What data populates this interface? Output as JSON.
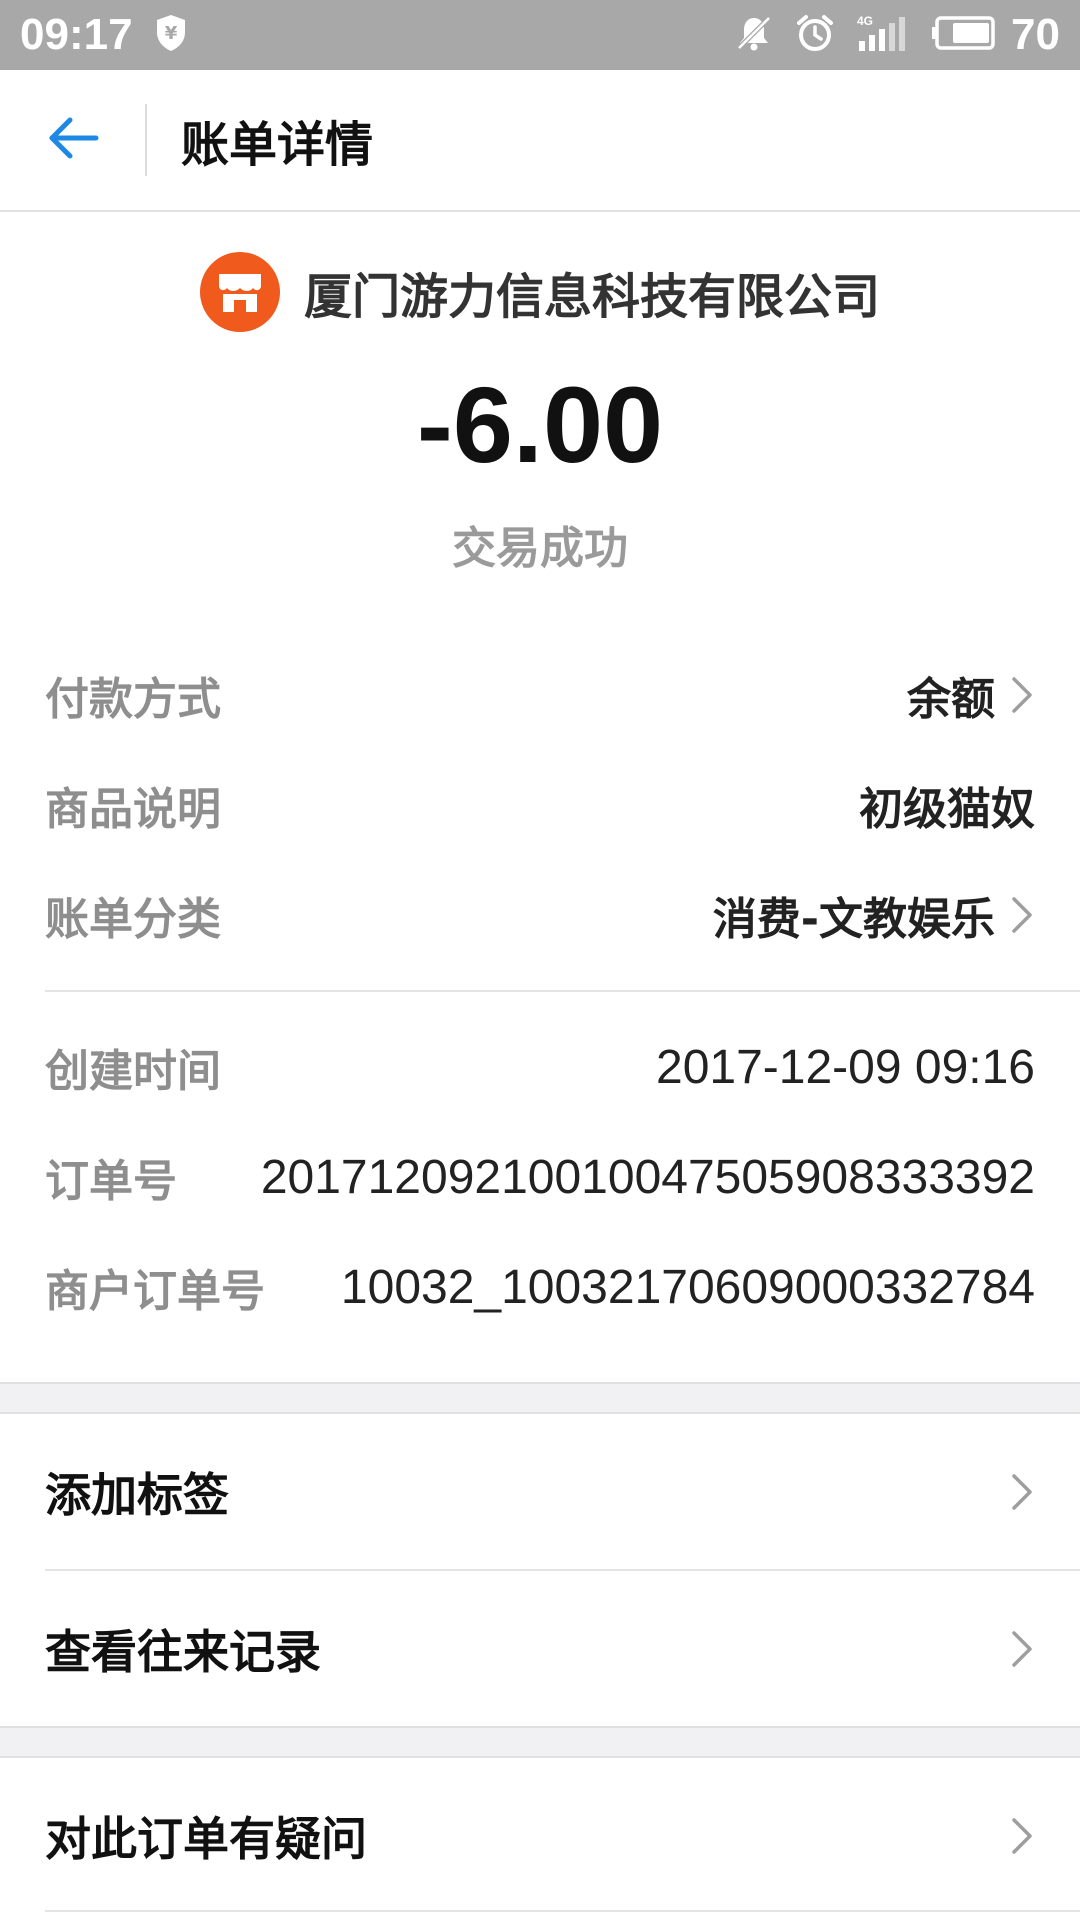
{
  "status_bar": {
    "time": "09:17",
    "network": "4G",
    "battery": "70",
    "icons": [
      "shield-yuan-icon",
      "bell-muted-icon",
      "alarm-icon",
      "signal-icon",
      "battery-icon"
    ]
  },
  "header": {
    "title": "账单详情",
    "back_icon": "arrow-left-icon"
  },
  "summary": {
    "merchant": "厦门游力信息科技有限公司",
    "merchant_icon": "store-icon",
    "amount": "-6.00",
    "status": "交易成功"
  },
  "details": [
    {
      "label": "付款方式",
      "value": "余额",
      "has_chevron": true
    },
    {
      "label": "商品说明",
      "value": "初级猫奴",
      "has_chevron": false
    },
    {
      "label": "账单分类",
      "value": "消费-文教娱乐",
      "has_chevron": true
    }
  ],
  "meta": [
    {
      "label": "创建时间",
      "value": "2017-12-09 09:16"
    },
    {
      "label": "订单号",
      "value": "20171209210010047505908333392"
    },
    {
      "label": "商户订单号",
      "value": "10032_10032170609000332784"
    }
  ],
  "actions": [
    {
      "label": "添加标签"
    },
    {
      "label": "查看往来记录"
    },
    {
      "label": "对此订单有疑问"
    }
  ],
  "colors": {
    "accent": "#1e88e5",
    "merchant_logo": "#f05a1c",
    "status_bar": "#a8a8a8",
    "label_gray": "#8e8e8e"
  }
}
